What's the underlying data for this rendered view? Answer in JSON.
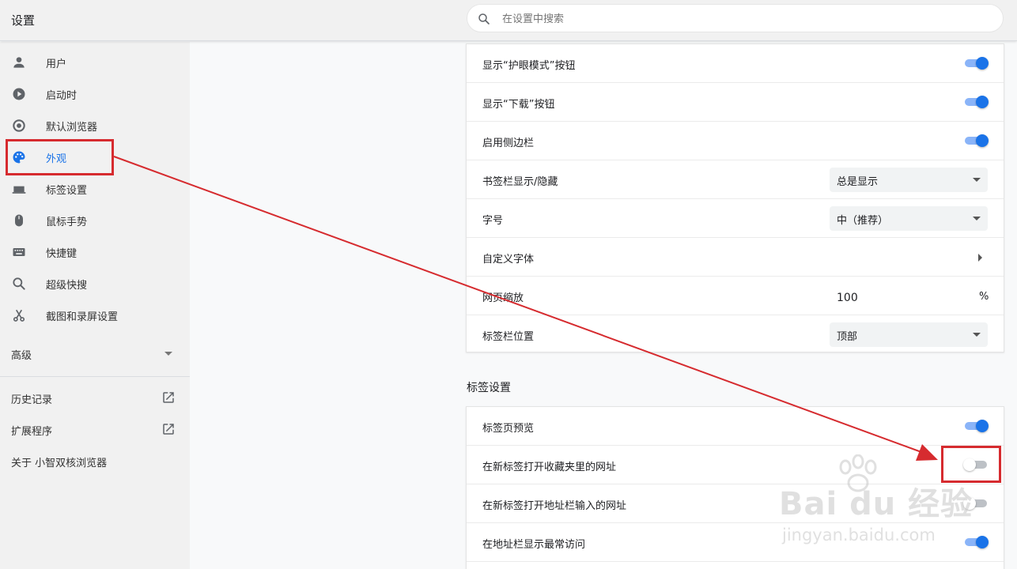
{
  "app": {
    "title": "设置"
  },
  "search": {
    "placeholder": "在设置中搜索"
  },
  "sidebar": {
    "items": [
      {
        "label": "用户",
        "icon": "person-icon"
      },
      {
        "label": "启动时",
        "icon": "play-circle-icon"
      },
      {
        "label": "默认浏览器",
        "icon": "target-icon"
      },
      {
        "label": "外观",
        "icon": "palette-icon",
        "active": true
      },
      {
        "label": "标签设置",
        "icon": "tab-icon"
      },
      {
        "label": "鼠标手势",
        "icon": "mouse-icon"
      },
      {
        "label": "快捷键",
        "icon": "keyboard-icon"
      },
      {
        "label": "超级快搜",
        "icon": "search-icon"
      },
      {
        "label": "截图和录屏设置",
        "icon": "scissors-icon"
      }
    ],
    "advanced_label": "高级",
    "links": [
      {
        "label": "历史记录",
        "icon": "open-in-new-icon"
      },
      {
        "label": "扩展程序",
        "icon": "open-in-new-icon"
      },
      {
        "label": "关于 小智双核浏览器"
      }
    ]
  },
  "appearance": {
    "rows": [
      {
        "label": "显示“护眼模式”按钮",
        "toggle": true
      },
      {
        "label": "显示“下载”按钮",
        "toggle": true
      },
      {
        "label": "启用侧边栏",
        "toggle": true
      },
      {
        "label": "书签栏显示/隐藏",
        "select": "总是显示"
      },
      {
        "label": "字号",
        "select": "中（推荐）"
      },
      {
        "label": "自定义字体"
      },
      {
        "label": "网页缩放",
        "value": "100",
        "unit": "%"
      },
      {
        "label": "标签栏位置",
        "select": "顶部"
      }
    ]
  },
  "tabs_section": {
    "title": "标签设置",
    "rows": [
      {
        "label": "标签页预览",
        "toggle": true
      },
      {
        "label": "在新标签打开收藏夹里的网址",
        "toggle": false
      },
      {
        "label": "在新标签打开地址栏输入的网址",
        "toggle": false
      },
      {
        "label": "在地址栏显示最常访问",
        "toggle": true
      }
    ]
  },
  "annotation": {
    "color": "#d62b2f"
  },
  "watermark": {
    "logo": "Bai du 经验",
    "url": "jingyan.baidu.com"
  },
  "colors": {
    "accent": "#1a73e8",
    "toggle_on_track": "#8ab4f8",
    "toggle_off_track": "#bdc1c6"
  }
}
